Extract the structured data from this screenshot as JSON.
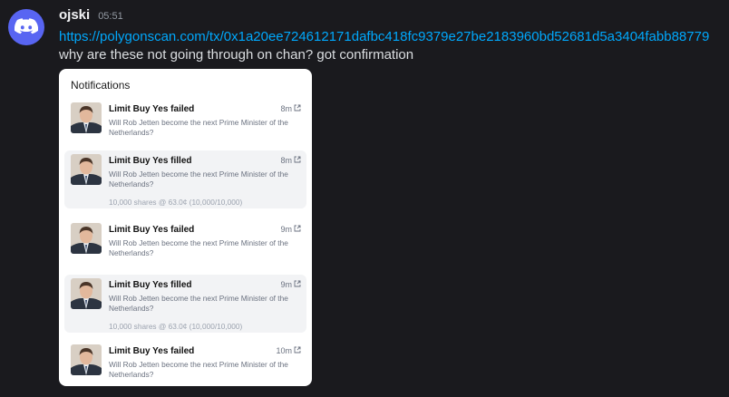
{
  "message": {
    "username": "ojski",
    "time": "05:51",
    "link": "https://polygonscan.com/tx/0x1a20ee724612171dafbc418fc9379e27be2183960bd52681d5a3404fabb88779",
    "text": "why are these not going through on chan? got confirmation"
  },
  "card": {
    "title": "Notifications",
    "items": [
      {
        "title": "Limit Buy Yes failed",
        "time": "8m",
        "question": "Will Rob Jetten become the next Prime Minister of the Netherlands?",
        "meta": ""
      },
      {
        "title": "Limit Buy Yes filled",
        "time": "8m",
        "question": "Will Rob Jetten become the next Prime Minister of the Netherlands?",
        "meta": "10,000 shares @ 63.0¢ (10,000/10,000)"
      },
      {
        "title": "Limit Buy Yes failed",
        "time": "9m",
        "question": "Will Rob Jetten become the next Prime Minister of the Netherlands?",
        "meta": ""
      },
      {
        "title": "Limit Buy Yes filled",
        "time": "9m",
        "question": "Will Rob Jetten become the next Prime Minister of the Netherlands?",
        "meta": "10,000 shares @ 63.0¢ (10,000/10,000)"
      },
      {
        "title": "Limit Buy Yes failed",
        "time": "10m",
        "question": "Will Rob Jetten become the next Prime Minister of the Netherlands?",
        "meta": ""
      }
    ]
  },
  "colors": {
    "background": "#1a1a1e",
    "discord_blurple": "#5865f2",
    "link": "#00a8fc",
    "card_bg": "#ffffff",
    "highlight": "#f2f3f5"
  },
  "icons": {
    "avatar": "discord-logo-icon",
    "external_link": "external-link-icon"
  }
}
